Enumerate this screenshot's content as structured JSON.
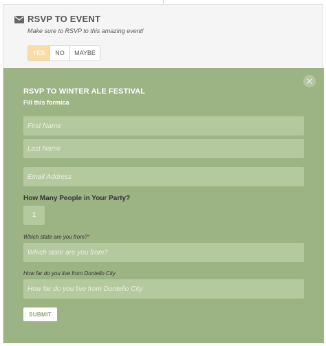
{
  "header": {
    "title": "RSVP TO EVENT",
    "subtitle": "Make sure to RSVP to this amazing event!",
    "icon": "envelope-icon"
  },
  "rsvp_choices": {
    "yes": "YES",
    "no": "NO",
    "maybe": "MAYBE",
    "selected": "YES"
  },
  "form": {
    "title": "RSVP TO WINTER ALE FESTIVAL",
    "subtitle": "Fill this formica",
    "first_name_placeholder": "First Name",
    "last_name_placeholder": "Last Name",
    "email_placeholder": "Email Address",
    "party_label": "How Many People in Your Party?",
    "party_value": "1",
    "state_label": "Which state are you from?",
    "state_required_mark": "*",
    "state_placeholder": "Which state are you from?",
    "distance_label": "How far do you live from Dontello City",
    "distance_placeholder": "How far do you live from Dontello City",
    "submit_label": "SUBMIT"
  },
  "colors": {
    "panel": "#9cb383",
    "field": "#b5c99f",
    "selected_choice": "#fbdca2"
  }
}
